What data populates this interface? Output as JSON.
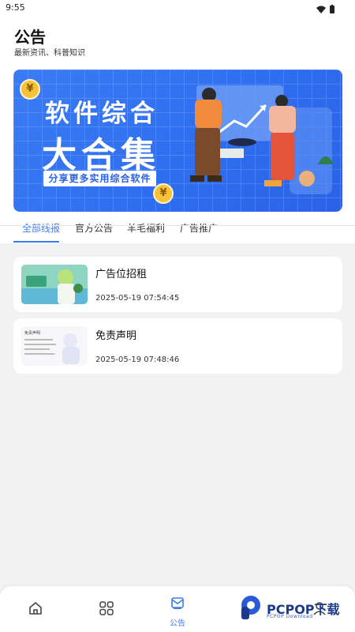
{
  "status": {
    "time": "9:55"
  },
  "header": {
    "title": "公告",
    "subtitle": "最新资讯、科普知识"
  },
  "banner": {
    "line1": "软件综合",
    "line2": "大合集",
    "tag": "分享更多实用综合软件",
    "coin_symbol": "¥"
  },
  "tabs": [
    {
      "label": "全部线报",
      "active": true
    },
    {
      "label": "官方公告",
      "active": false
    },
    {
      "label": "羊毛福利",
      "active": false
    },
    {
      "label": "广告推广",
      "active": false
    }
  ],
  "posts": [
    {
      "title": "广告位招租",
      "date": "2025-05-19 07:54:45",
      "thumb": "anime-character-thumbnail"
    },
    {
      "title": "免责声明",
      "date": "2025-05-19 07:48:46",
      "thumb": "disclaimer-thumbnail"
    }
  ],
  "thumb2_caption": "免责声明",
  "bottom_nav": [
    {
      "icon": "home-icon",
      "label": ""
    },
    {
      "icon": "grid-icon",
      "label": ""
    },
    {
      "icon": "announcement-icon",
      "label": "公告",
      "active": true
    },
    {
      "icon": "profile-icon",
      "label": ""
    }
  ],
  "watermark": {
    "text": "PCPOP下载",
    "sub": "PCPOP Download"
  },
  "colors": {
    "accent": "#3b7bf2",
    "banner_bg": "#2f6ef0",
    "coin": "#f7c23a"
  }
}
